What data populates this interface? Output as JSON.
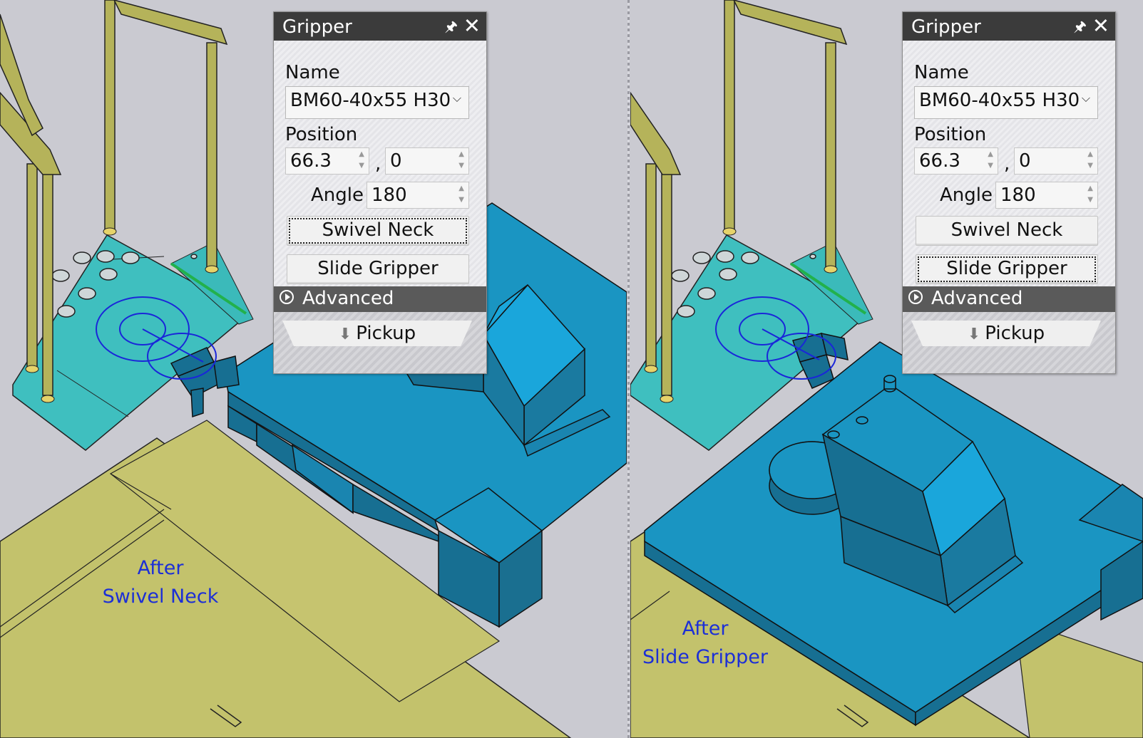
{
  "captions": {
    "left_line1": "After",
    "left_line2": "Swivel Neck",
    "right_line1": "After",
    "right_line2": "Slide Gripper"
  },
  "panels": [
    {
      "title": "Gripper",
      "name_label": "Name",
      "name_value": "BM60-40x55 H30",
      "position_label": "Position",
      "position_x": "66.3",
      "position_sep": ",",
      "position_y": "0",
      "angle_label": "Angle",
      "angle_value": "180",
      "swivel_neck_label": "Swivel Neck",
      "slide_gripper_label": "Slide Gripper",
      "focused_button": "swivel",
      "advanced_label": "Advanced",
      "pickup_label": "Pickup"
    },
    {
      "title": "Gripper",
      "name_label": "Name",
      "name_value": "BM60-40x55 H30",
      "position_label": "Position",
      "position_x": "66.3",
      "position_sep": ",",
      "position_y": "0",
      "angle_label": "Angle",
      "angle_value": "180",
      "swivel_neck_label": "Swivel Neck",
      "slide_gripper_label": "Slide Gripper",
      "focused_button": "slide",
      "advanced_label": "Advanced",
      "pickup_label": "Pickup"
    }
  ],
  "icons": {
    "pin": "pin-icon",
    "close": "close-icon",
    "advanced": "expand-circle-icon",
    "pickup": "down-arrow-icon",
    "dropdown": "chevron-down-icon"
  },
  "colors": {
    "background": "#cacad1",
    "machine_blue": "#1a95c2",
    "sheet_teal": "#3fbfbf",
    "floor_olive": "#c3c26c",
    "rail_tan": "#b5b35a",
    "caption_blue": "#1c2fd6",
    "gripper_path": "#1a26d9",
    "edge_green": "#22b14c"
  }
}
